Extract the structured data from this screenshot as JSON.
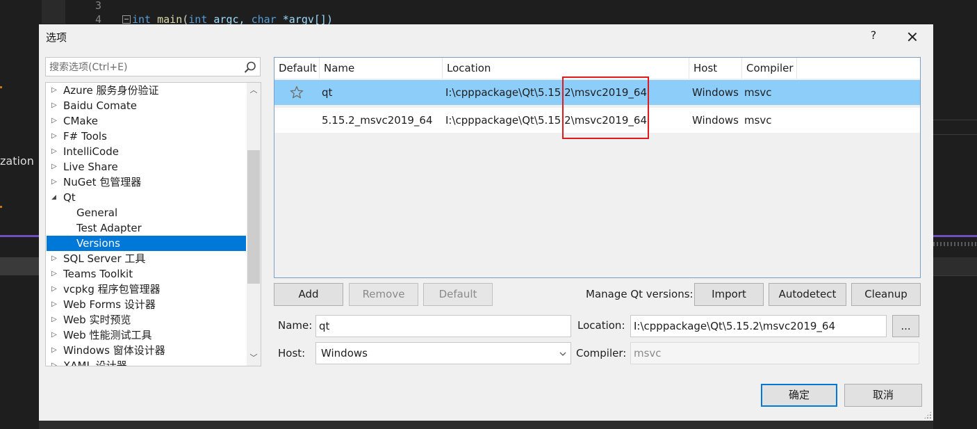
{
  "editor": {
    "line3": "3",
    "line4": "4",
    "code_kw1": "int",
    "code_fn": "main",
    "code_args_kw": "int",
    "code_argc": "argc,",
    "code_char": "char",
    "code_argv": "*argv[])",
    "side_text": "zation"
  },
  "dialog": {
    "title": "选项",
    "help": "?",
    "search_placeholder": "搜索选项(Ctrl+E)"
  },
  "tree": {
    "items": [
      {
        "label": "Azure 服务身份验证",
        "arrow": "▷"
      },
      {
        "label": "Baidu Comate",
        "arrow": "▷"
      },
      {
        "label": "CMake",
        "arrow": "▷"
      },
      {
        "label": "F# Tools",
        "arrow": "▷"
      },
      {
        "label": "IntelliCode",
        "arrow": "▷"
      },
      {
        "label": "Live Share",
        "arrow": "▷"
      },
      {
        "label": "NuGet 包管理器",
        "arrow": "▷"
      },
      {
        "label": "Qt",
        "arrow": "◢"
      },
      {
        "label": "General"
      },
      {
        "label": "Test Adapter"
      },
      {
        "label": "Versions"
      },
      {
        "label": "SQL Server 工具",
        "arrow": "▷"
      },
      {
        "label": "Teams Toolkit",
        "arrow": "▷"
      },
      {
        "label": "vcpkg 程序包管理器",
        "arrow": "▷"
      },
      {
        "label": "Web Forms 设计器",
        "arrow": "▷"
      },
      {
        "label": "Web 实时预览",
        "arrow": "▷"
      },
      {
        "label": "Web 性能测试工具",
        "arrow": "▷"
      },
      {
        "label": "Windows 窗体设计器",
        "arrow": "▷"
      },
      {
        "label": "XAML 设计器",
        "arrow": "▷"
      }
    ]
  },
  "versions_table": {
    "columns": [
      "Default",
      "Name",
      "Location",
      "Host",
      "Compiler"
    ],
    "rows": [
      {
        "default": "star",
        "name": "qt",
        "location": "I:\\cpppackage\\Qt\\5.15.2\\msvc2019_64",
        "host": "Windows",
        "compiler": "msvc"
      },
      {
        "default": "",
        "name": "5.15.2_msvc2019_64",
        "location": "I:\\cpppackage\\Qt\\5.15.2\\msvc2019_64",
        "host": "Windows",
        "compiler": "msvc"
      }
    ]
  },
  "actions": {
    "add": "Add",
    "remove": "Remove",
    "default": "Default",
    "manage_label": "Manage Qt versions:",
    "import": "Import",
    "autodetect": "Autodetect",
    "cleanup": "Cleanup"
  },
  "form": {
    "name_label": "Name:",
    "name_value": "qt",
    "location_label": "Location:",
    "location_value": "I:\\cpppackage\\Qt\\5.15.2\\msvc2019_64",
    "browse": "...",
    "host_label": "Host:",
    "host_value": "Windows",
    "compiler_label": "Compiler:",
    "compiler_value": "msvc"
  },
  "footer": {
    "ok": "确定",
    "cancel": "取消"
  },
  "colors": {
    "selection": "#0078d7",
    "row_selected": "#8dcdf9",
    "annotation": "#e0191d",
    "editor_bg": "#1e1e1e"
  }
}
